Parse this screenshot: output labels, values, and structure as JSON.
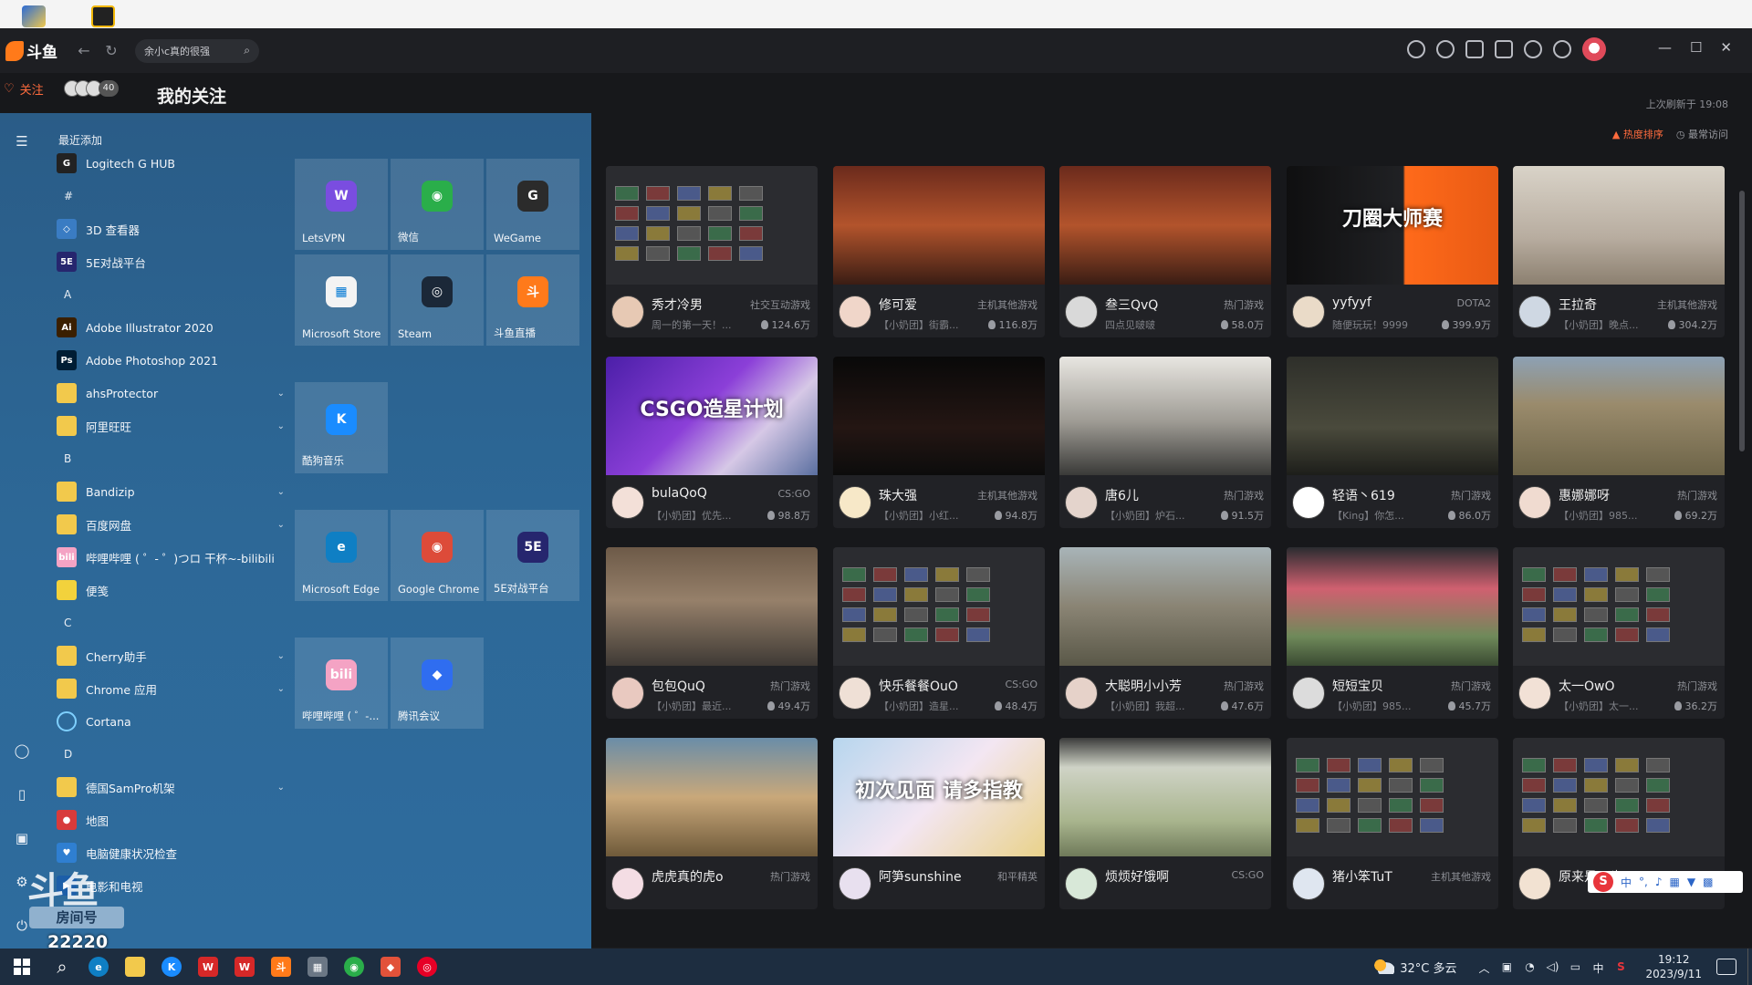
{
  "app": {
    "logo_text": "斗鱼",
    "search": {
      "value": "余小c真的很强"
    },
    "follow_tab": "关注",
    "follow_count": "40",
    "page_title": "我的关注",
    "refresh_time": "上次刷新于 19:08",
    "sort_hot": "热度排序",
    "sort_recent": "最常访问"
  },
  "streams": [
    {
      "name": "秀才冷男",
      "category": "社交互动游戏",
      "desc": "周一的第一天！...",
      "heat": "124.6万",
      "thumb": "grid",
      "overlay": ""
    },
    {
      "name": "修可爱",
      "category": "主机其他游戏",
      "desc": "【小奶团】街霸...",
      "heat": "116.8万",
      "thumb": "fight",
      "overlay": ""
    },
    {
      "name": "叁三QvQ",
      "category": "热门游戏",
      "desc": "四点见啵啵",
      "heat": "58.0万",
      "thumb": "fight",
      "overlay": ""
    },
    {
      "name": "yyfyyf",
      "category": "DOTA2",
      "desc": "随便玩玩！9999",
      "heat": "399.9万",
      "thumb": "dota",
      "overlay": "刀圈大师赛"
    },
    {
      "name": "王拉奇",
      "category": "主机其他游戏",
      "desc": "【小奶团】晚点...",
      "heat": "304.2万",
      "thumb": "gym",
      "overlay": ""
    },
    {
      "name": "bulaQoQ",
      "category": "CS:GO",
      "desc": "【小奶团】优先...",
      "heat": "98.8万",
      "thumb": "csgo",
      "overlay": "CSGO造星计划"
    },
    {
      "name": "珠大强",
      "category": "主机其他游戏",
      "desc": "【小奶团】小红...",
      "heat": "94.8万",
      "thumb": "dark",
      "overlay": ""
    },
    {
      "name": "唐6儿",
      "category": "热门游戏",
      "desc": "【小奶团】炉石...",
      "heat": "91.5万",
      "thumb": "ink",
      "overlay": ""
    },
    {
      "name": "轻语丶619",
      "category": "热门游戏",
      "desc": "【King】你怎...",
      "heat": "86.0万",
      "thumb": "soldiers",
      "overlay": ""
    },
    {
      "name": "惠娜娜呀",
      "category": "热门游戏",
      "desc": "【小奶团】985...",
      "heat": "69.2万",
      "thumb": "field",
      "overlay": ""
    },
    {
      "name": "包包QuQ",
      "category": "热门游戏",
      "desc": "【小奶团】最近...",
      "heat": "49.4万",
      "thumb": "val",
      "overlay": ""
    },
    {
      "name": "快乐餐餐OuO",
      "category": "CS:GO",
      "desc": "【小奶团】造星...",
      "heat": "48.4万",
      "thumb": "grid",
      "overlay": ""
    },
    {
      "name": "大聪明小小芳",
      "category": "热门游戏",
      "desc": "【小奶团】我超...",
      "heat": "47.6万",
      "thumb": "street",
      "overlay": ""
    },
    {
      "name": "短短宝贝",
      "category": "热门游戏",
      "desc": "【小奶团】985...",
      "heat": "45.7万",
      "thumb": "tent",
      "overlay": ""
    },
    {
      "name": "太一OwO",
      "category": "热门游戏",
      "desc": "【小奶团】太一...",
      "heat": "36.2万",
      "thumb": "grid",
      "overlay": ""
    },
    {
      "name": "虎虎真的虎o",
      "category": "热门游戏",
      "desc": "",
      "heat": "",
      "thumb": "beach",
      "overlay": ""
    },
    {
      "name": "阿笋sunshine",
      "category": "和平精英",
      "desc": "",
      "heat": "",
      "thumb": "anime",
      "overlay": "初次见面 请多指教"
    },
    {
      "name": "烦烦好饿啊",
      "category": "CS:GO",
      "desc": "",
      "heat": "",
      "thumb": "sim",
      "overlay": ""
    },
    {
      "name": "猪小笨TuT",
      "category": "主机其他游戏",
      "desc": "",
      "heat": "",
      "thumb": "grid",
      "overlay": ""
    },
    {
      "name": "原来是王也...",
      "category": "主机其他游戏",
      "desc": "",
      "heat": "",
      "thumb": "grid",
      "overlay": ""
    }
  ],
  "start_menu": {
    "recent_header": "最近添加",
    "items": [
      {
        "kind": "app",
        "label": "Logitech G HUB",
        "icon": "logitech-icon",
        "color": "#222222",
        "glyph": "G"
      },
      {
        "kind": "letter",
        "label": "#"
      },
      {
        "kind": "app",
        "label": "3D 查看器",
        "icon": "cube-icon",
        "color": "#3a7cc3",
        "glyph": "◇"
      },
      {
        "kind": "app",
        "label": "5E对战平台",
        "icon": "5e-icon",
        "color": "#26266e",
        "glyph": "5E"
      },
      {
        "kind": "letter",
        "label": "A"
      },
      {
        "kind": "app",
        "label": "Adobe Illustrator 2020",
        "icon": "illustrator-icon",
        "color": "#3a1f00",
        "glyph": "Ai"
      },
      {
        "kind": "app",
        "label": "Adobe Photoshop 2021",
        "icon": "photoshop-icon",
        "color": "#001d34",
        "glyph": "Ps"
      },
      {
        "kind": "folder",
        "label": "ahsProtector"
      },
      {
        "kind": "folder",
        "label": "阿里旺旺"
      },
      {
        "kind": "letter",
        "label": "B"
      },
      {
        "kind": "folder",
        "label": "Bandizip"
      },
      {
        "kind": "folder",
        "label": "百度网盘"
      },
      {
        "kind": "app",
        "label": "哔哩哔哩 ( ゜- ゜)つロ 干杯~-bilibili",
        "icon": "bilibili-icon",
        "color": "#f4a3c4",
        "glyph": "bili"
      },
      {
        "kind": "app",
        "label": "便笺",
        "icon": "sticky-note-icon",
        "color": "#f2d23c",
        "glyph": ""
      },
      {
        "kind": "letter",
        "label": "C"
      },
      {
        "kind": "folder",
        "label": "Cherry助手"
      },
      {
        "kind": "folder",
        "label": "Chrome 应用"
      },
      {
        "kind": "app",
        "label": "Cortana",
        "icon": "cortana-icon",
        "color": "transparent",
        "glyph": "○"
      },
      {
        "kind": "letter",
        "label": "D"
      },
      {
        "kind": "folder",
        "label": "德国SamPro机架"
      },
      {
        "kind": "app",
        "label": "地图",
        "icon": "maps-icon",
        "color": "#d83b3b",
        "glyph": "●"
      },
      {
        "kind": "app",
        "label": "电脑健康状况检查",
        "icon": "health-check-icon",
        "color": "#2f7fd1",
        "glyph": "♥"
      },
      {
        "kind": "app",
        "label": "电影和电视",
        "icon": "movies-icon",
        "color": "#1c5ea8",
        "glyph": "▶"
      }
    ],
    "tiles": [
      {
        "label": "LetsVPN",
        "icon": "letsvpn-icon",
        "color": "#7a4de0",
        "glyph": "W"
      },
      {
        "label": "微信",
        "icon": "wechat-icon",
        "color": "#2aae4a",
        "glyph": "◉"
      },
      {
        "label": "WeGame",
        "icon": "wegame-icon",
        "color": "#2b2b2b",
        "glyph": "G"
      },
      {
        "label": "Microsoft Store",
        "icon": "store-icon",
        "color": "#f3f3f3",
        "glyph": "▦"
      },
      {
        "label": "Steam",
        "icon": "steam-icon",
        "color": "#1b2838",
        "glyph": "◎"
      },
      {
        "label": "斗鱼直播",
        "icon": "douyu-icon",
        "color": "#ff7a1a",
        "glyph": "斗"
      },
      {
        "label": "酷狗音乐",
        "icon": "kugou-icon",
        "color": "#1a8cff",
        "glyph": "K"
      },
      {
        "label": "Microsoft Edge",
        "icon": "edge-icon",
        "color": "#0f7fc4",
        "glyph": "e"
      },
      {
        "label": "Google Chrome",
        "icon": "chrome-icon",
        "color": "#dd4b39",
        "glyph": "◉"
      },
      {
        "label": "5E对战平台",
        "icon": "5e-icon",
        "color": "#26266e",
        "glyph": "5E"
      },
      {
        "label": "哔哩哔哩 ( ゜-...",
        "icon": "bilibili-icon",
        "color": "#f4a3c4",
        "glyph": "bili"
      },
      {
        "label": "腾讯会议",
        "icon": "tencent-meeting-icon",
        "color": "#2f6df0",
        "glyph": "◆"
      }
    ]
  },
  "watermark": {
    "logo": "斗鱼",
    "badge": "房间号",
    "room": "22220"
  },
  "taskbar": {
    "weather": "32°C 多云",
    "ime": "中",
    "time": "19:12",
    "date": "2023/9/11"
  }
}
